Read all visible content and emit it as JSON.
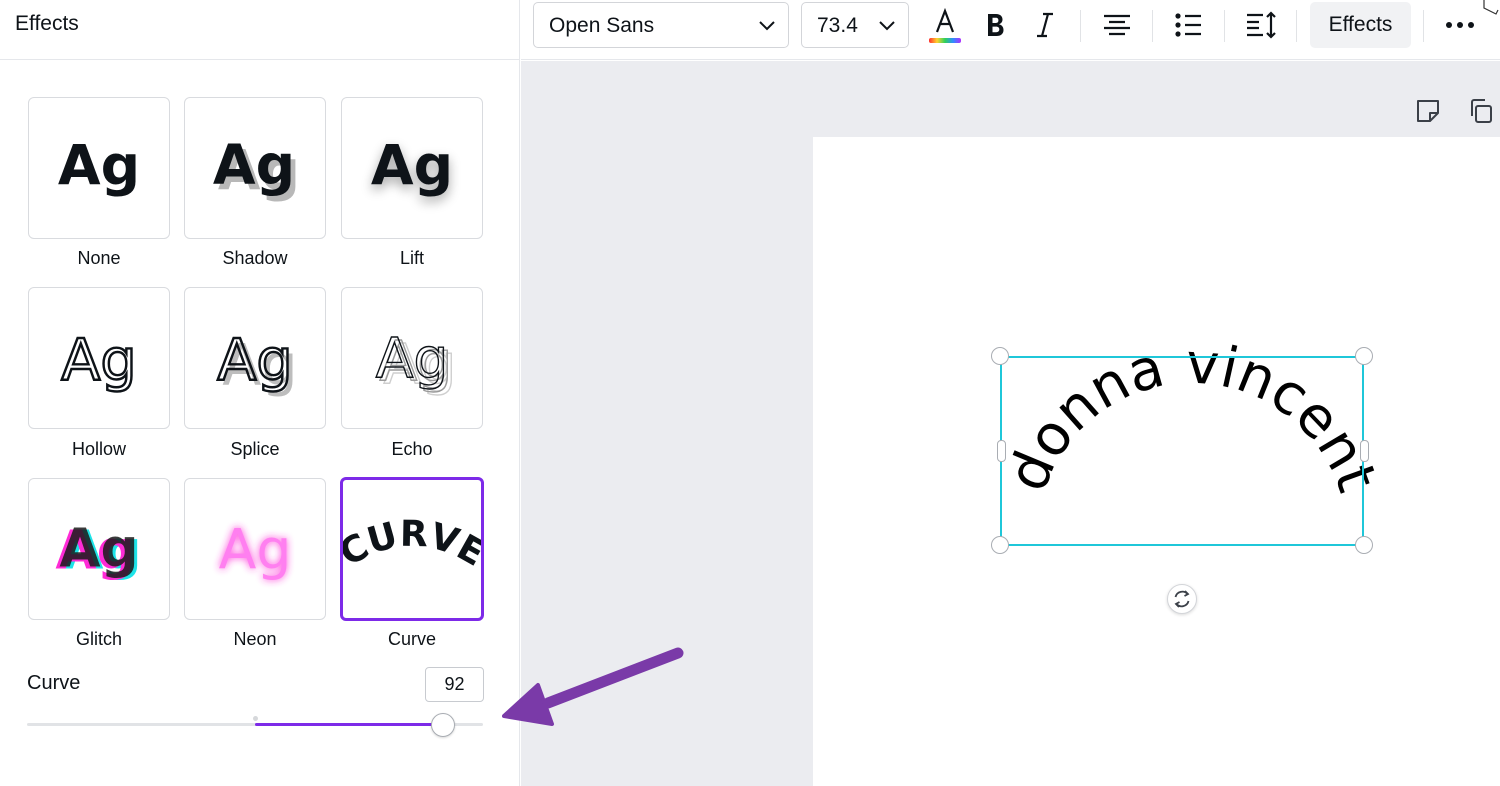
{
  "panel": {
    "title": "Effects",
    "effects": [
      {
        "label": "None",
        "preview": "Ag"
      },
      {
        "label": "Shadow",
        "preview": "Ag"
      },
      {
        "label": "Lift",
        "preview": "Ag"
      },
      {
        "label": "Hollow",
        "preview": "Ag"
      },
      {
        "label": "Splice",
        "preview": "Ag"
      },
      {
        "label": "Echo",
        "preview": "Ag"
      },
      {
        "label": "Glitch",
        "preview": "Ag"
      },
      {
        "label": "Neon",
        "preview": "Ag"
      },
      {
        "label": "Curve",
        "preview": "CURVE"
      }
    ],
    "selected_effect": "Curve",
    "curve_label": "Curve",
    "curve_value": "92",
    "curve_fraction": 0.92
  },
  "toolbar": {
    "font": "Open Sans",
    "font_size": "73.4",
    "effects_label": "Effects",
    "icons": [
      "text-color-icon",
      "bold-icon",
      "italic-icon",
      "align-center-icon",
      "list-icon",
      "spacing-icon",
      "more-icon"
    ]
  },
  "canvas": {
    "curved_text": "donna vincent",
    "icons": [
      "sticky-note-icon",
      "duplicate-icon",
      "rotate-icon"
    ]
  },
  "colors": {
    "accent": "#7d2ae8",
    "selection": "#1fc7d9",
    "neon": "#ff2bd6",
    "glitch_cyan": "#1de4e8",
    "glitch_magenta": "#ff2bd6"
  }
}
